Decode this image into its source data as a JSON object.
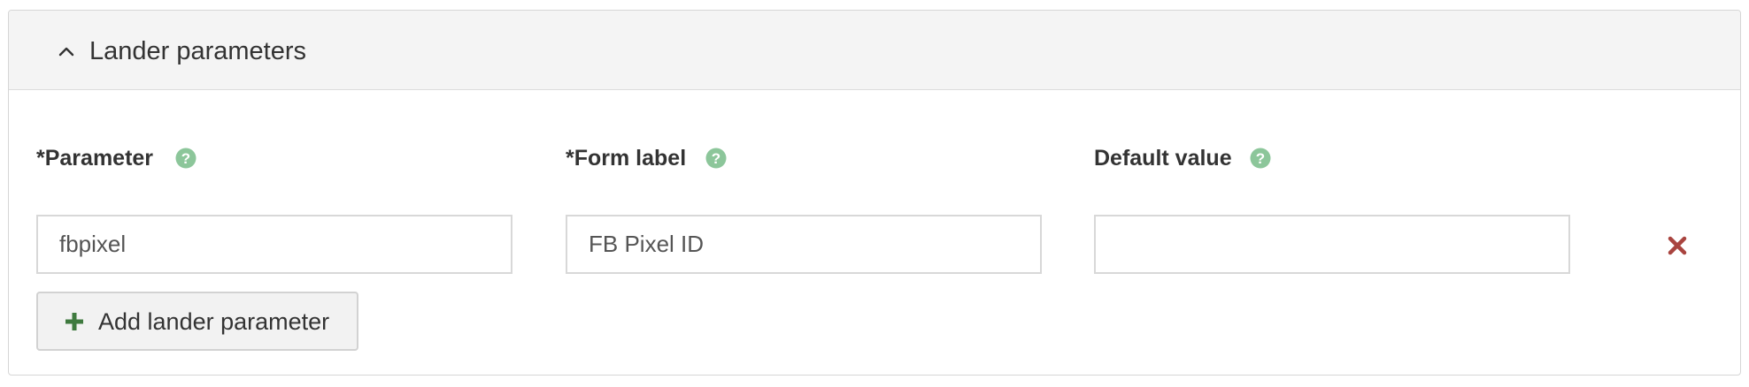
{
  "panel": {
    "title": "Lander parameters",
    "collapse_icon": "chevron-up-icon"
  },
  "columns": [
    {
      "label": "*Parameter",
      "value": "fbpixel",
      "placeholder": "",
      "help_icon": "question-circle-icon"
    },
    {
      "label": "*Form label",
      "value": "FB Pixel ID",
      "placeholder": "",
      "help_icon": "question-circle-icon"
    },
    {
      "label": "Default value",
      "value": "",
      "placeholder": "",
      "help_icon": "question-circle-icon"
    }
  ],
  "remove_icon": "remove-x-icon",
  "add_button": {
    "label": "Add lander parameter",
    "icon": "plus-icon"
  },
  "colors": {
    "help_icon": "#8cc69a",
    "remove_icon": "#a9443f",
    "plus_icon": "#3f7a3f"
  }
}
